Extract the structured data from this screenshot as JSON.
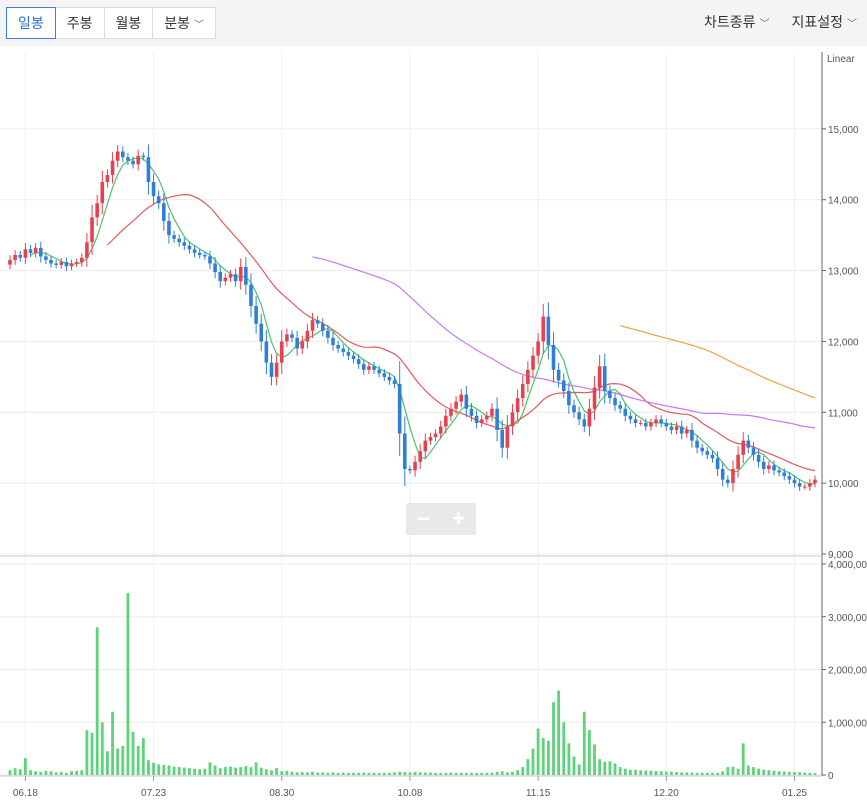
{
  "toolbar": {
    "tabs": [
      {
        "label": "일봉",
        "active": true
      },
      {
        "label": "주봉",
        "active": false
      },
      {
        "label": "월봉",
        "active": false
      },
      {
        "label": "분봉",
        "active": false,
        "dropdown": true
      }
    ],
    "chart_type_label": "차트종류",
    "indicator_label": "지표설정"
  },
  "zoom": {
    "minus": "−",
    "plus": "+"
  },
  "chart_data": [
    {
      "type": "candlestick",
      "title": "",
      "scale_label": "Linear",
      "ylim": [
        9000,
        16000
      ],
      "y_ticks": [
        9000,
        10000,
        11000,
        12000,
        13000,
        14000,
        15000
      ],
      "y_tick_labels": [
        "9,000",
        "10,000",
        "11,000",
        "12,000",
        "13,000",
        "14,000",
        "15,000"
      ],
      "x_tick_labels": [
        "06.18",
        "07.23",
        "08.30",
        "10.08",
        "11.15",
        "12.20",
        "01.25"
      ],
      "x_tick_index": [
        3,
        28,
        53,
        78,
        103,
        128,
        153
      ],
      "colors": {
        "up": "#e8404f",
        "down": "#2f7ed8",
        "ma5": "#4cc26f",
        "ma20": "#e05a5a",
        "ma60": "#c47bf0",
        "ma120": "#f0a040"
      },
      "closes": [
        13150,
        13220,
        13180,
        13300,
        13250,
        13320,
        13200,
        13150,
        13100,
        13080,
        13120,
        13060,
        13100,
        13120,
        13180,
        13400,
        13750,
        13950,
        14250,
        14350,
        14550,
        14680,
        14600,
        14550,
        14500,
        14620,
        14600,
        14250,
        14050,
        13950,
        13700,
        13500,
        13450,
        13400,
        13350,
        13300,
        13250,
        13220,
        13200,
        13100,
        12980,
        12850,
        12900,
        12950,
        12850,
        13050,
        12800,
        12500,
        12250,
        12000,
        11700,
        11500,
        11700,
        12000,
        12100,
        12050,
        11900,
        12000,
        12150,
        12300,
        12250,
        12150,
        12050,
        11950,
        11900,
        11850,
        11800,
        11750,
        11680,
        11600,
        11650,
        11600,
        11550,
        11500,
        11450,
        11400,
        10700,
        10200,
        10180,
        10300,
        10450,
        10600,
        10650,
        10700,
        10800,
        10950,
        11050,
        11150,
        11250,
        11050,
        10950,
        10850,
        10900,
        10950,
        11050,
        10750,
        10500,
        10800,
        11000,
        11200,
        11400,
        11600,
        11800,
        12000,
        12350,
        11950,
        11600,
        11450,
        11300,
        11100,
        11000,
        10900,
        10800,
        11050,
        11350,
        11650,
        11300,
        11200,
        11100,
        11050,
        10950,
        10900,
        10850,
        10850,
        10800,
        10850,
        10900,
        10850,
        10800,
        10750,
        10800,
        10700,
        10750,
        10600,
        10500,
        10450,
        10400,
        10350,
        10200,
        10050,
        10000,
        10200,
        10400,
        10600,
        10500,
        10400,
        10300,
        10200,
        10250,
        10180,
        10150,
        10100,
        10050,
        10000,
        9950,
        9950,
        10000,
        10050
      ],
      "volumes": [
        90000,
        130000,
        110000,
        320000,
        90000,
        70000,
        60000,
        80000,
        70000,
        50000,
        60000,
        40000,
        70000,
        80000,
        90000,
        850000,
        800000,
        2800000,
        1000000,
        450000,
        1200000,
        500000,
        550000,
        3450000,
        820000,
        550000,
        700000,
        280000,
        230000,
        200000,
        190000,
        180000,
        160000,
        150000,
        140000,
        130000,
        120000,
        110000,
        120000,
        240000,
        180000,
        130000,
        150000,
        160000,
        140000,
        150000,
        170000,
        150000,
        240000,
        140000,
        110000,
        90000,
        130000,
        70000,
        80000,
        60000,
        50000,
        55000,
        50000,
        60000,
        45000,
        50000,
        40000,
        50000,
        40000,
        45000,
        40000,
        42000,
        40000,
        43000,
        40000,
        42000,
        40000,
        45000,
        40000,
        50000,
        60000,
        55000,
        50000,
        60000,
        52000,
        48000,
        45000,
        40000,
        42000,
        40000,
        45000,
        40000,
        42000,
        40000,
        43000,
        38000,
        40000,
        42000,
        45000,
        60000,
        70000,
        50000,
        60000,
        90000,
        150000,
        300000,
        500000,
        880000,
        700000,
        650000,
        1380000,
        1600000,
        1000000,
        600000,
        350000,
        200000,
        1200000,
        850000,
        580000,
        300000,
        250000,
        260000,
        220000,
        150000,
        120000,
        100000,
        95000,
        90000,
        85000,
        80000,
        75000,
        70000,
        65000,
        60000,
        55000,
        50000,
        48000,
        45000,
        44000,
        43000,
        42000,
        40000,
        42000,
        70000,
        150000,
        160000,
        120000,
        600000,
        180000,
        150000,
        120000,
        100000,
        90000,
        80000,
        70000,
        65000,
        60000,
        55000,
        50000,
        45000,
        40000,
        35000
      ],
      "volume_ylim": [
        0,
        4000000
      ],
      "volume_ticks": [
        0,
        1000000,
        2000000,
        3000000,
        4000000
      ],
      "volume_tick_labels": [
        "0",
        "1,000,00",
        "2,000,00",
        "3,000,00",
        "4,000,00"
      ]
    }
  ]
}
